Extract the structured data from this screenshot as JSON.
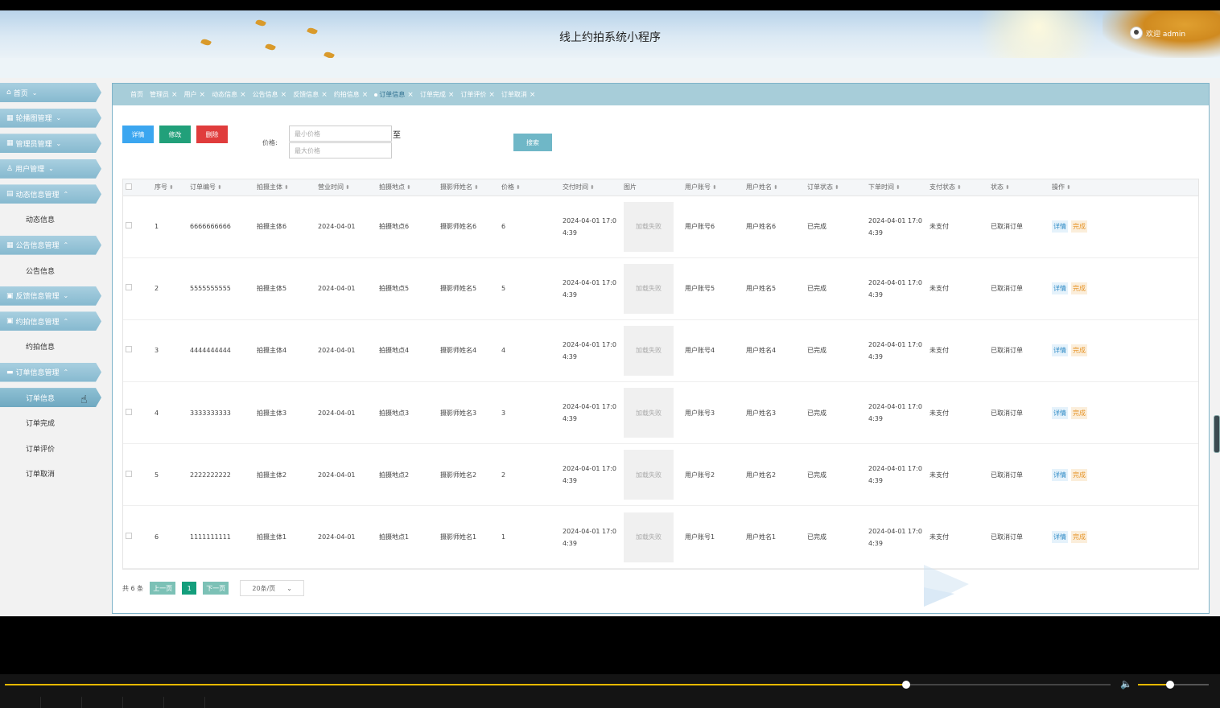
{
  "header": {
    "title": "线上约拍系统小程序",
    "welcome": "欢迎 admin"
  },
  "sidebar": {
    "menus": [
      {
        "icon": "home-icon",
        "glyph": "⌂",
        "label": "首页",
        "expanded": false,
        "children": []
      },
      {
        "icon": "carousel-icon",
        "glyph": "▦",
        "label": "轮播图管理",
        "expanded": false,
        "children": []
      },
      {
        "icon": "admin-icon",
        "glyph": "▦",
        "label": "管理员管理",
        "expanded": false,
        "children": []
      },
      {
        "icon": "user-icon",
        "glyph": "♙",
        "label": "用户管理",
        "expanded": false,
        "children": []
      },
      {
        "icon": "news-icon",
        "glyph": "▤",
        "label": "动态信息管理",
        "expanded": true,
        "children": [
          "动态信息"
        ]
      },
      {
        "icon": "notice-icon",
        "glyph": "▦",
        "label": "公告信息管理",
        "expanded": true,
        "children": [
          "公告信息"
        ]
      },
      {
        "icon": "feedback-icon",
        "glyph": "▣",
        "label": "反馈信息管理",
        "expanded": false,
        "children": []
      },
      {
        "icon": "booking-icon",
        "glyph": "▣",
        "label": "约拍信息管理",
        "expanded": true,
        "children": [
          "约拍信息"
        ]
      },
      {
        "icon": "order-icon",
        "glyph": "▬",
        "label": "订单信息管理",
        "expanded": true,
        "children": [
          "订单信息",
          "订单完成",
          "订单评价",
          "订单取消"
        ]
      }
    ],
    "active_item": "订单信息"
  },
  "tabs": [
    {
      "label": "首页",
      "closable": false,
      "active": false
    },
    {
      "label": "管理员",
      "closable": true,
      "active": false
    },
    {
      "label": "用户",
      "closable": true,
      "active": false
    },
    {
      "label": "动态信息",
      "closable": true,
      "active": false
    },
    {
      "label": "公告信息",
      "closable": true,
      "active": false
    },
    {
      "label": "反馈信息",
      "closable": true,
      "active": false
    },
    {
      "label": "约拍信息",
      "closable": true,
      "active": false
    },
    {
      "label": "订单信息",
      "closable": true,
      "active": true
    },
    {
      "label": "订单完成",
      "closable": true,
      "active": false
    },
    {
      "label": "订单评价",
      "closable": true,
      "active": false
    },
    {
      "label": "订单取消",
      "closable": true,
      "active": false
    }
  ],
  "toolbar": {
    "detail": "详情",
    "edit": "修改",
    "delete": "删除",
    "price_label": "价格:",
    "price_min_placeholder": "最小价格",
    "price_max_placeholder": "最大价格",
    "price_to": "至",
    "search": "搜索"
  },
  "table": {
    "columns": [
      "序号",
      "订单编号",
      "拍摄主体",
      "营业时间",
      "拍摄地点",
      "摄影师姓名",
      "价格",
      "交付时间",
      "图片",
      "用户账号",
      "用户姓名",
      "订单状态",
      "下单时间",
      "支付状态",
      "状态",
      "操作"
    ],
    "image_fail": "加载失败",
    "op_detail": "详情",
    "op_done": "完成",
    "rows": [
      {
        "no": "1",
        "order_no": "6666666666",
        "subject": "拍摄主体6",
        "biz_time": "2024-04-01",
        "location": "拍摄地点6",
        "photographer": "摄影师姓名6",
        "price": "6",
        "deliver_time": "2024-04-01 17:0 4:39",
        "account": "用户账号6",
        "username": "用户姓名6",
        "order_status": "已完成",
        "order_time": "2024-04-01 17:0 4:39",
        "pay_status": "未支付",
        "status": "已取消订单"
      },
      {
        "no": "2",
        "order_no": "5555555555",
        "subject": "拍摄主体5",
        "biz_time": "2024-04-01",
        "location": "拍摄地点5",
        "photographer": "摄影师姓名5",
        "price": "5",
        "deliver_time": "2024-04-01 17:0 4:39",
        "account": "用户账号5",
        "username": "用户姓名5",
        "order_status": "已完成",
        "order_time": "2024-04-01 17:0 4:39",
        "pay_status": "未支付",
        "status": "已取消订单"
      },
      {
        "no": "3",
        "order_no": "4444444444",
        "subject": "拍摄主体4",
        "biz_time": "2024-04-01",
        "location": "拍摄地点4",
        "photographer": "摄影师姓名4",
        "price": "4",
        "deliver_time": "2024-04-01 17:0 4:39",
        "account": "用户账号4",
        "username": "用户姓名4",
        "order_status": "已完成",
        "order_time": "2024-04-01 17:0 4:39",
        "pay_status": "未支付",
        "status": "已取消订单"
      },
      {
        "no": "4",
        "order_no": "3333333333",
        "subject": "拍摄主体3",
        "biz_time": "2024-04-01",
        "location": "拍摄地点3",
        "photographer": "摄影师姓名3",
        "price": "3",
        "deliver_time": "2024-04-01 17:0 4:39",
        "account": "用户账号3",
        "username": "用户姓名3",
        "order_status": "已完成",
        "order_time": "2024-04-01 17:0 4:39",
        "pay_status": "未支付",
        "status": "已取消订单"
      },
      {
        "no": "5",
        "order_no": "2222222222",
        "subject": "拍摄主体2",
        "biz_time": "2024-04-01",
        "location": "拍摄地点2",
        "photographer": "摄影师姓名2",
        "price": "2",
        "deliver_time": "2024-04-01 17:0 4:39",
        "account": "用户账号2",
        "username": "用户姓名2",
        "order_status": "已完成",
        "order_time": "2024-04-01 17:0 4:39",
        "pay_status": "未支付",
        "status": "已取消订单"
      },
      {
        "no": "6",
        "order_no": "1111111111",
        "subject": "拍摄主体1",
        "biz_time": "2024-04-01",
        "location": "拍摄地点1",
        "photographer": "摄影师姓名1",
        "price": "1",
        "deliver_time": "2024-04-01 17:0 4:39",
        "account": "用户账号1",
        "username": "用户姓名1",
        "order_status": "已完成",
        "order_time": "2024-04-01 17:0 4:39",
        "pay_status": "未支付",
        "status": "已取消订单"
      }
    ]
  },
  "pager": {
    "total": "共 6 条",
    "prev": "上一页",
    "current": "1",
    "next": "下一页",
    "page_size": "20条/页"
  },
  "video": {
    "progress": 0.815,
    "volume": 0.45
  },
  "colors": {
    "menu": "#86b9cf",
    "tabs": "#a7cdd9",
    "detail": "#3ba6f0",
    "edit": "#21a07a",
    "delete": "#e03c3c",
    "accent": "#e6b800"
  }
}
